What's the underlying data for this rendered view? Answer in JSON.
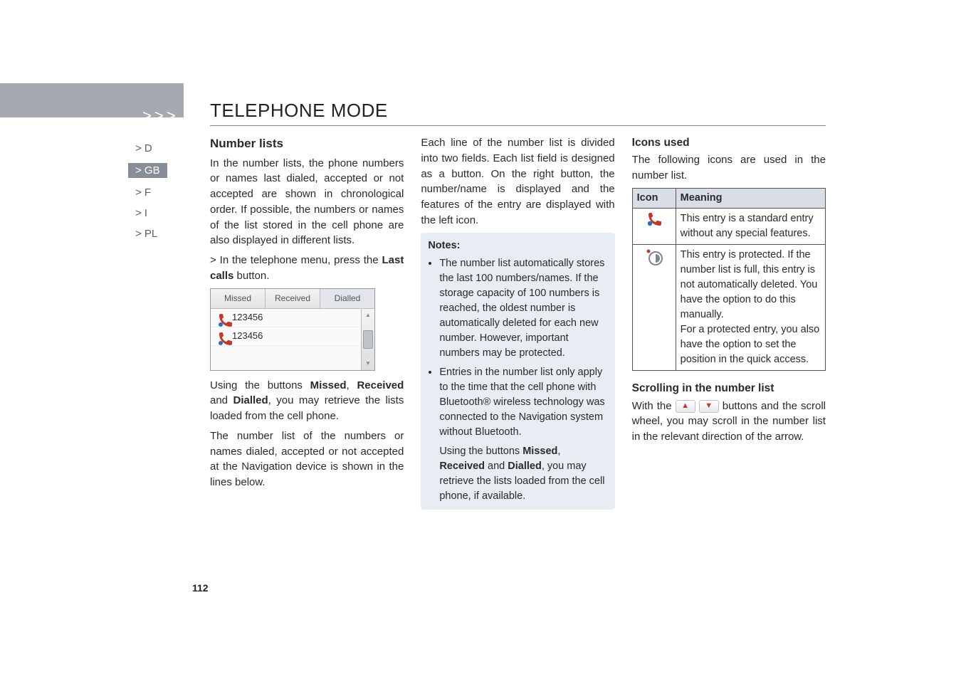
{
  "header": {
    "arrows": ">>>",
    "title": "TELEPHONE MODE"
  },
  "nav": {
    "items": [
      "> D",
      "> GB",
      "> F",
      "> I",
      "> PL"
    ],
    "active_index": 1
  },
  "col1": {
    "heading": "Number lists",
    "para1": "In the number lists, the phone numbers or names last dialed, accepted or not accepted are shown in chronological order. If possible, the numbers or names of the list stored in the cell phone are also displayed in different lists.",
    "step_prefix": "> In the telephone menu, press the ",
    "step_button": "Last calls",
    "step_suffix": " button.",
    "tabs": [
      "Missed",
      "Received",
      "Dialled"
    ],
    "rows": [
      "123456",
      "123456"
    ],
    "para2_a": "Using the buttons ",
    "para2_b1": "Missed",
    "para2_b2": "Received",
    "para2_b3": "Dialled",
    "para2_c": ", you may retrieve the lists loaded from the cell phone.",
    "para3": "The number list of the numbers or names dialed, accepted or not accepted at the Navigation device is shown in the lines below."
  },
  "col2": {
    "para1": "Each line of the number list is divided into two fields. Each list field is designed as a button. On the right button, the number/name is displayed and the features of the entry are displayed with the left icon.",
    "notes_title": "Notes:",
    "note1": "The number list automatically stores the last 100 numbers/names. If the storage capacity of 100 numbers is reached, the oldest number is automatically deleted for each new number. However, important numbers may be protected.",
    "note2": "Entries in the number list only apply to the time that the cell phone with Bluetooth® wireless technology was connected to the Navigation system without Bluetooth.",
    "note3_a": "Using the buttons ",
    "note3_b1": "Missed",
    "note3_b2": "Received",
    "note3_b3": "Dialled",
    "note3_c": ", you may retrieve the lists loaded from the cell phone, if available."
  },
  "col3": {
    "heading": "Icons used",
    "intro": "The following icons are used in the number list.",
    "th_icon": "Icon",
    "th_meaning": "Meaning",
    "row1": "This entry is a standard entry without any special features.",
    "row2": "This entry is protected. If the number list is full, this entry is not automatically deleted. You have the option to do this manually.\nFor a protected entry, you also have the option to set the position in the quick access.",
    "scroll_heading": "Scrolling in the number list",
    "scroll_a": "With the ",
    "scroll_b": " buttons and the scroll wheel, you may scroll in the number list in the relevant direction of the arrow."
  },
  "page_number": "112"
}
